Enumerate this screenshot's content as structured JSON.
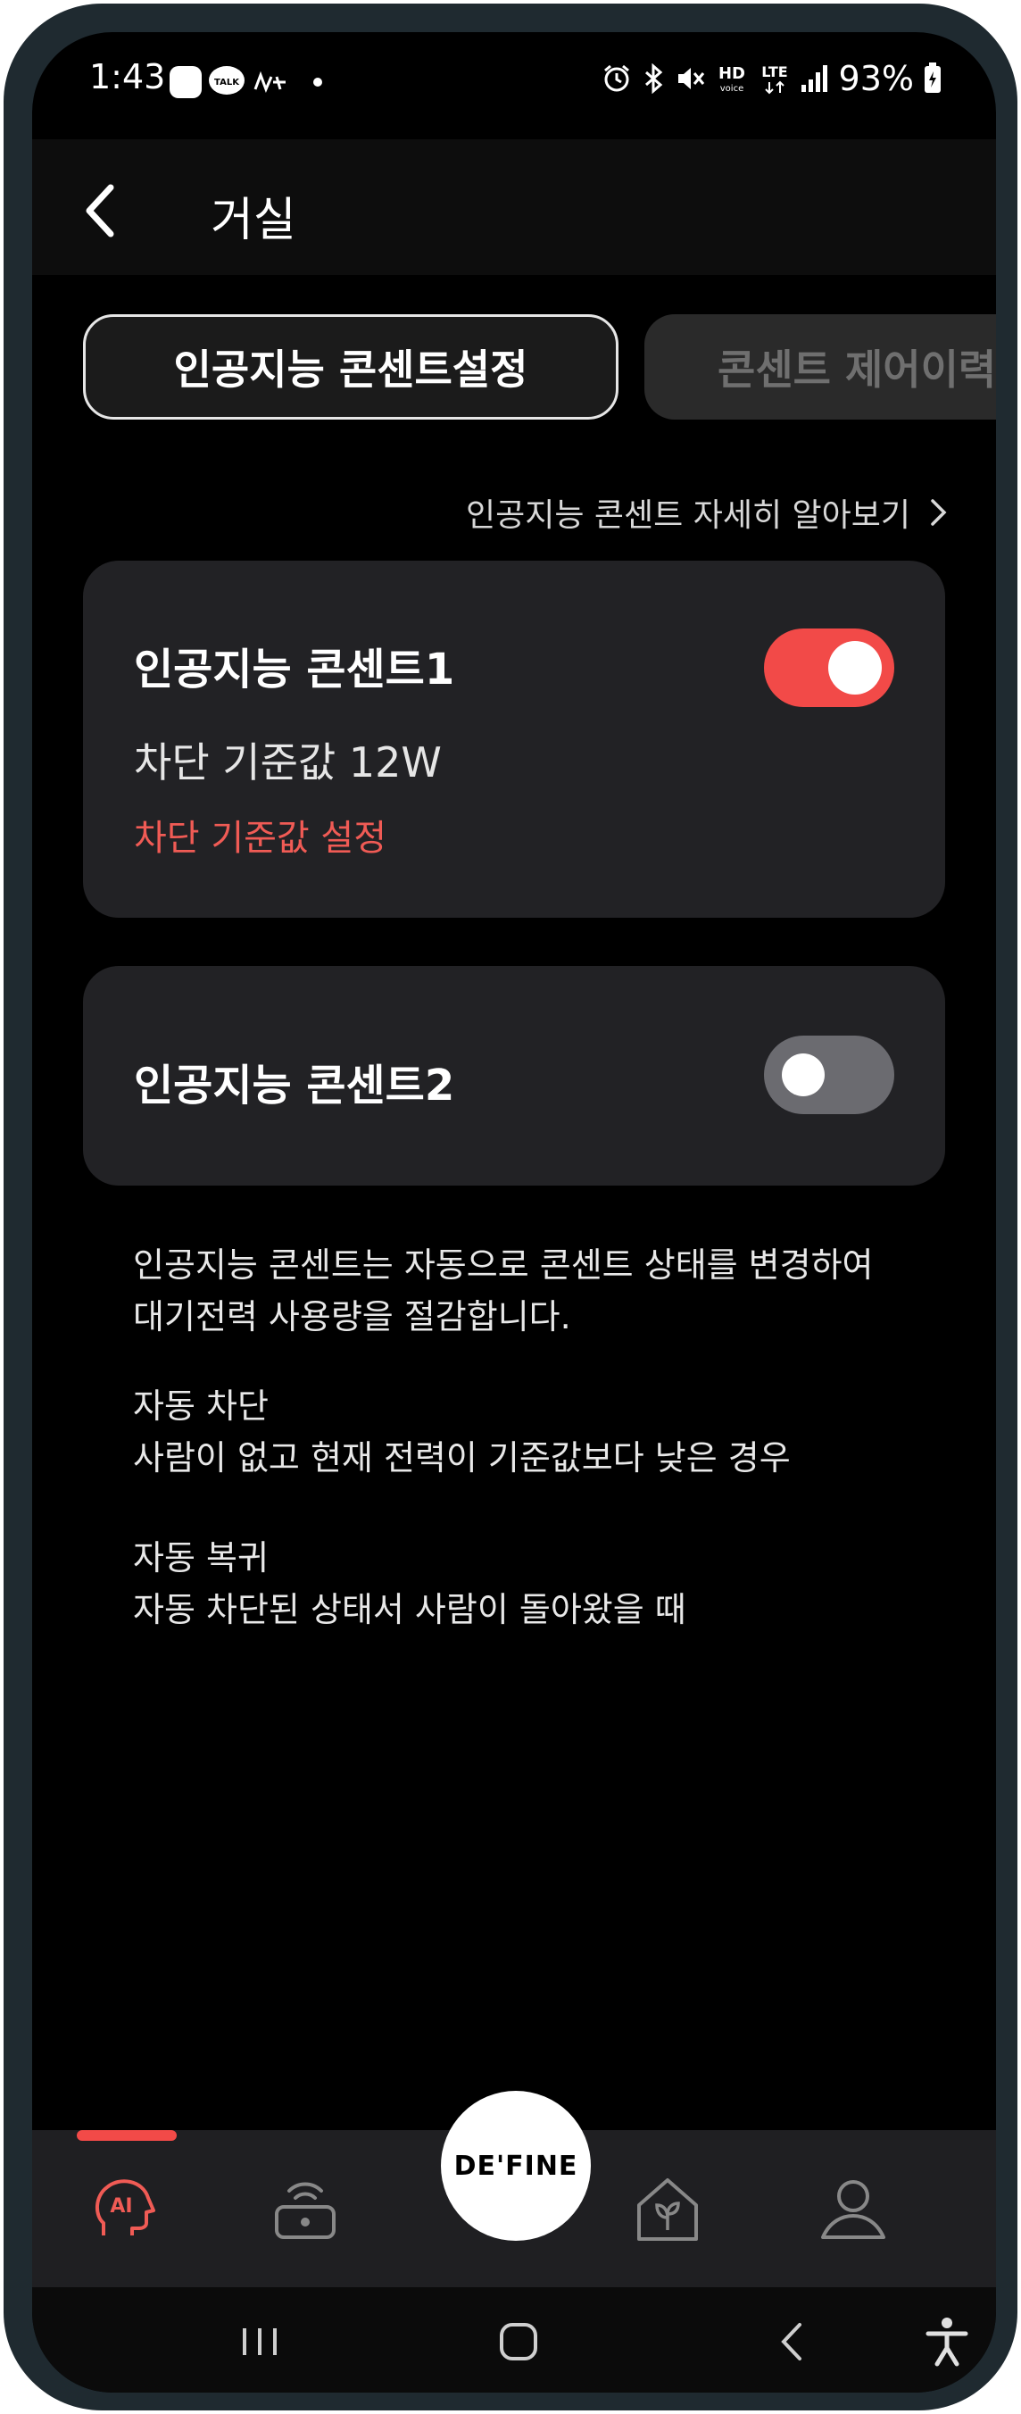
{
  "status_bar": {
    "time": "1:43",
    "battery": "93%",
    "icons": [
      "chat-icon",
      "kakaotalk-icon",
      "app-icon",
      "dot-icon",
      "alarm-icon",
      "bluetooth-icon",
      "mute-icon",
      "hd-voice-icon",
      "lte-icon",
      "signal-icon",
      "battery-icon"
    ],
    "talk_label": "TALK",
    "hd_label": "HD",
    "voice_label": "voice",
    "lte_label": "LTE"
  },
  "header": {
    "title": "거실",
    "back_icon": "chevron-left-icon"
  },
  "tabs": [
    {
      "label": "인공지능 콘센트설정",
      "active": true
    },
    {
      "label": "콘센트 제어이력",
      "active": false
    }
  ],
  "learn_more": {
    "label": "인공지능 콘센트 자세히 알아보기",
    "icon": "chevron-right-icon"
  },
  "outlets": [
    {
      "name": "인공지능 콘센트1",
      "enabled": true,
      "threshold_text": "차단 기준값 12W",
      "threshold_link": "차단 기준값 설정"
    },
    {
      "name": "인공지능 콘센트2",
      "enabled": false
    }
  ],
  "description": {
    "intro": [
      "인공지능 콘센트는 자동으로 콘센트 상태를 변경하여",
      "대기전력 사용량을 절감합니다."
    ],
    "auto_off": [
      "자동 차단",
      "사람이 없고 현재 전력이 기준값보다 낮은 경우"
    ],
    "auto_restore": [
      "자동 복귀",
      "자동 차단된 상태서 사람이 돌아왔을 때"
    ]
  },
  "bottom_nav": {
    "items": [
      "ai-head-icon",
      "router-icon",
      "home-plant-icon",
      "profile-icon"
    ],
    "ai_label": "AI",
    "center_label": "DE'FINE",
    "active_index": 0
  },
  "system_nav": [
    "recent-apps-icon",
    "home-icon",
    "back-icon",
    "accessibility-icon"
  ],
  "colors": {
    "accent": "#f24a48",
    "card": "#222225",
    "background": "#000000"
  }
}
